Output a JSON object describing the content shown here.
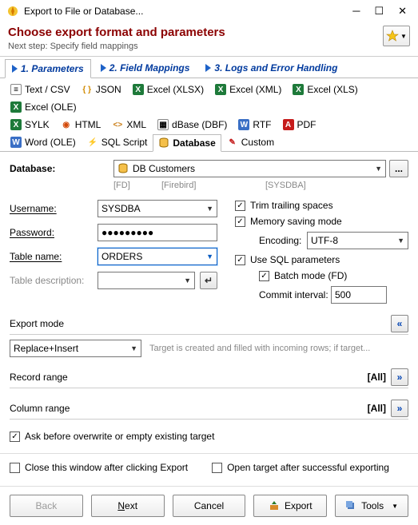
{
  "window": {
    "title": "Export to File or Database..."
  },
  "header": {
    "title": "Choose export format and parameters",
    "sub": "Next step: Specify field mappings"
  },
  "wizard_tabs": {
    "t1": "1. Parameters",
    "t2": "2. Field Mappings",
    "t3": "3. Logs and Error Handling"
  },
  "formats": {
    "text": "Text / CSV",
    "json": "JSON",
    "xlsx": "Excel (XLSX)",
    "xlsxml": "Excel (XML)",
    "xls": "Excel (XLS)",
    "ole": "Excel (OLE)",
    "sylk": "SYLK",
    "html": "HTML",
    "xml": "XML",
    "dbf": "dBase (DBF)",
    "rtf": "RTF",
    "pdf": "PDF",
    "word": "Word (OLE)",
    "sql": "SQL Script",
    "database": "Database",
    "custom": "Custom"
  },
  "db": {
    "label": "Database:",
    "value": "DB Customers",
    "meta1": "[FD]",
    "meta2": "[Firebird]",
    "meta3": "[SYSDBA]",
    "user_label": "Username:",
    "user_value": "SYSDBA",
    "pass_label": "Password:",
    "pass_value": "●●●●●●●●●",
    "table_label": "Table name:",
    "table_value": "ORDERS",
    "tdesc_label": "Table description:"
  },
  "opts": {
    "trim": "Trim trailing spaces",
    "mem": "Memory saving mode",
    "enc_label": "Encoding:",
    "enc_value": "UTF-8",
    "sqlp": "Use SQL parameters",
    "batch": "Batch mode (FD)",
    "commit_label": "Commit interval:",
    "commit_value": "500"
  },
  "export_mode": {
    "label": "Export mode",
    "value": "Replace+Insert",
    "desc": "Target is created and filled with incoming rows; if target..."
  },
  "ranges": {
    "record": "Record range",
    "column": "Column range",
    "all": "[All]"
  },
  "ask_overwrite": "Ask before overwrite or empty existing target",
  "footer": {
    "close_after": "Close this window after clicking Export",
    "open_after": "Open target after successful exporting"
  },
  "buttons": {
    "back": "Back",
    "next": "Next",
    "cancel": "Cancel",
    "export": "Export",
    "tools": "Tools"
  }
}
